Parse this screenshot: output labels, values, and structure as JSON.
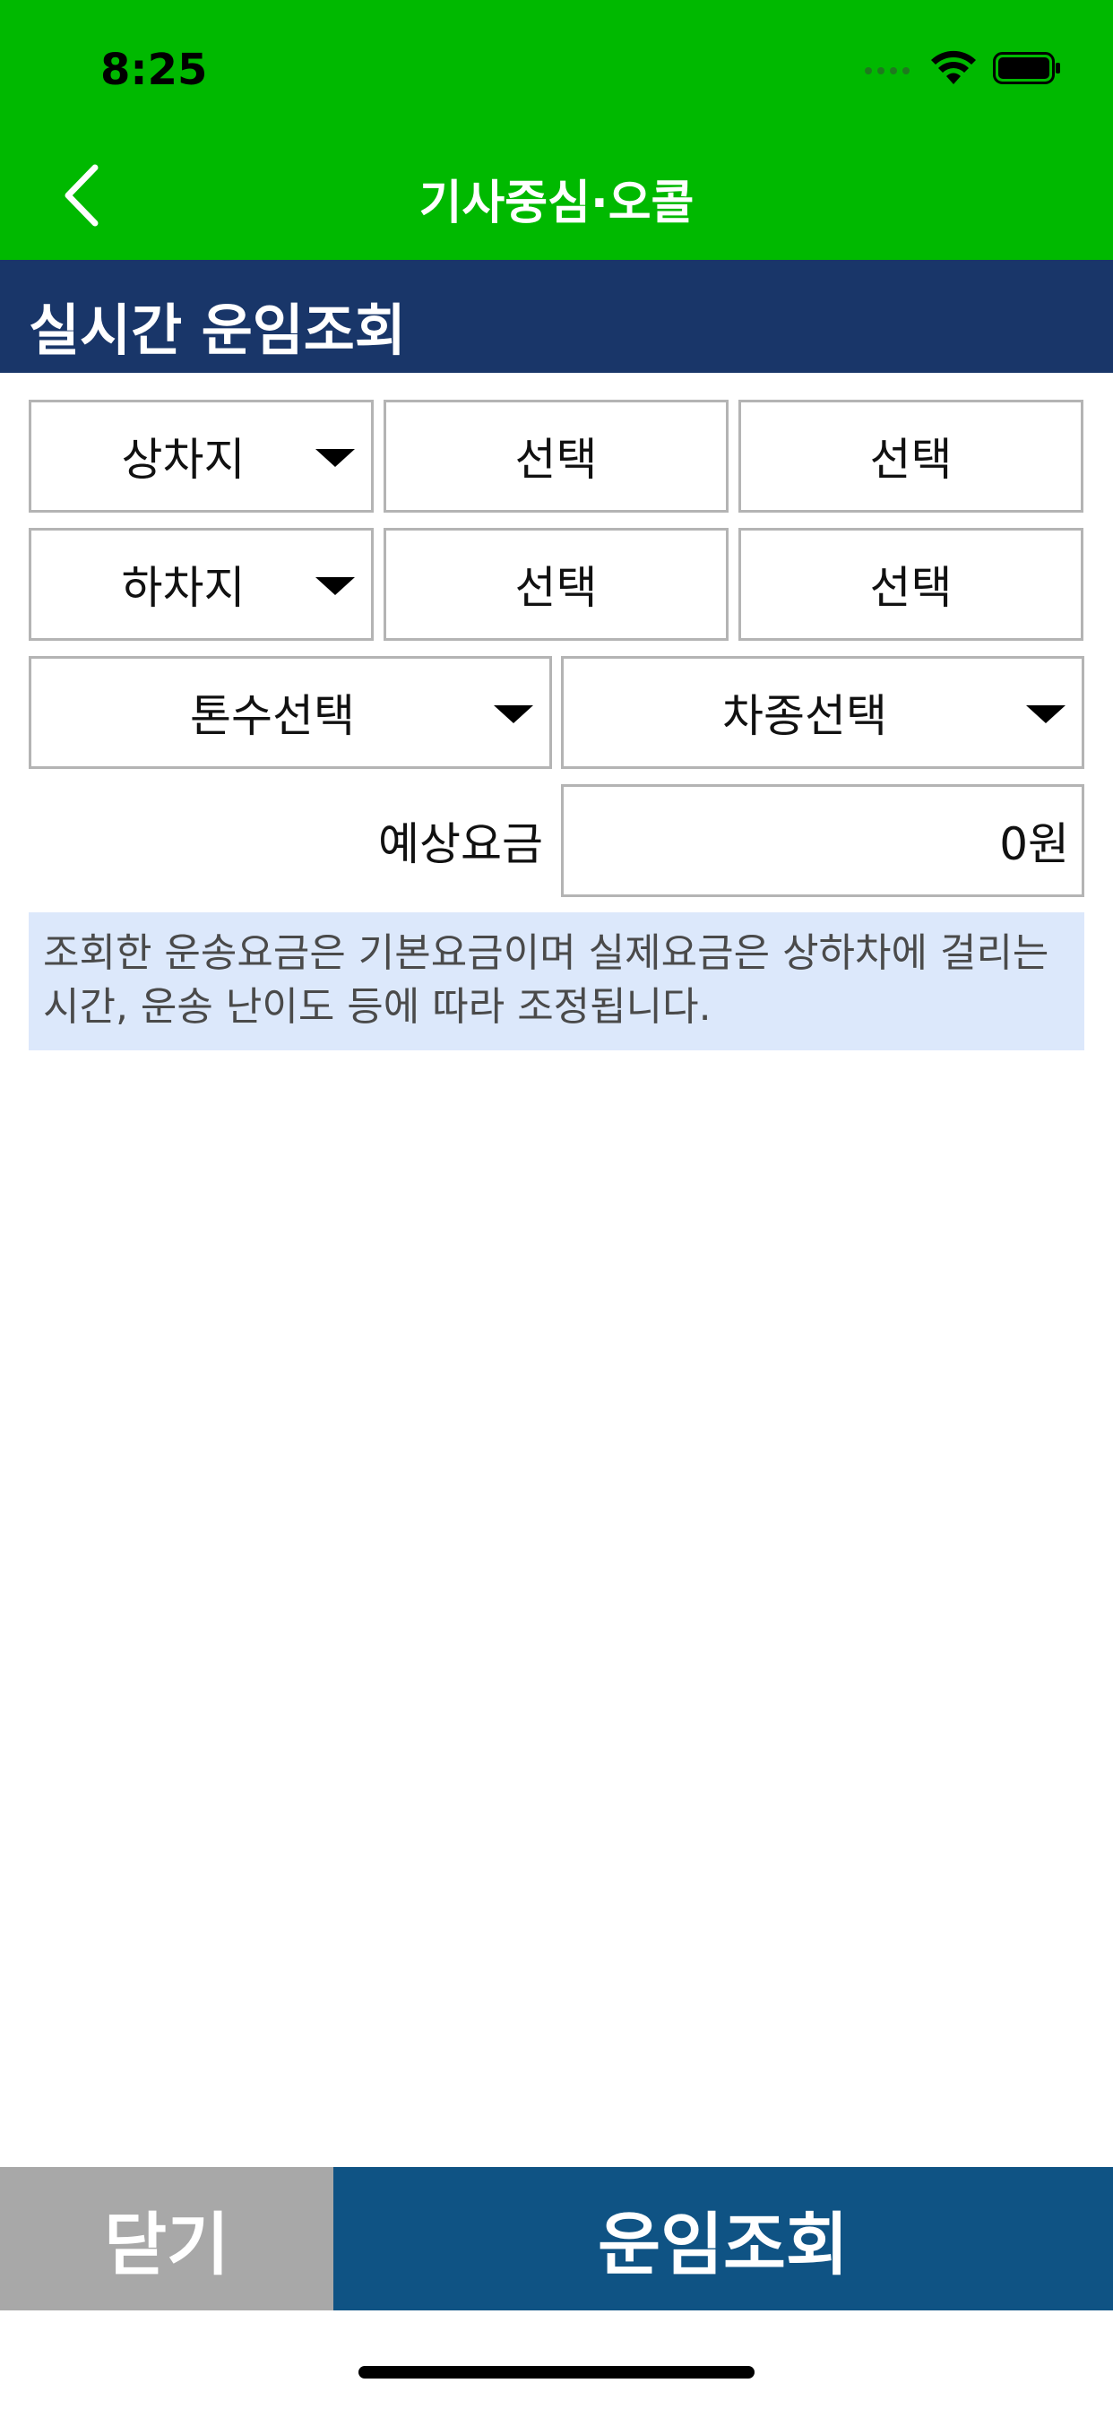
{
  "status_bar": {
    "time": "8:25",
    "icons": [
      "signal-icon",
      "wifi-icon",
      "battery-icon"
    ]
  },
  "nav": {
    "title": "기사중심·오콜",
    "back_icon": "chevron-left-icon"
  },
  "section": {
    "title": "실시간 운임조회"
  },
  "form": {
    "pickup": {
      "label": "상차지",
      "select1": "선택",
      "select2": "선택"
    },
    "dropoff": {
      "label": "하차지",
      "select1": "선택",
      "select2": "선택"
    },
    "tonnage": {
      "label": "톤수선택"
    },
    "vehicle_type": {
      "label": "차종선택"
    },
    "fare": {
      "label": "예상요금",
      "value": "0원"
    }
  },
  "notice": {
    "text": "조회한 운송요금은 기본요금이며 실제요금은 상하차에 걸리는 시간, 운송 난이도 등에 따라 조정됩니다."
  },
  "buttons": {
    "close": "닫기",
    "search": "운임조회"
  },
  "colors": {
    "status_bg": "#00b900",
    "section_bg": "#193669",
    "notice_bg": "#dce8fb",
    "close_bg": "#a8a8a8",
    "search_bg": "#0f5384"
  }
}
